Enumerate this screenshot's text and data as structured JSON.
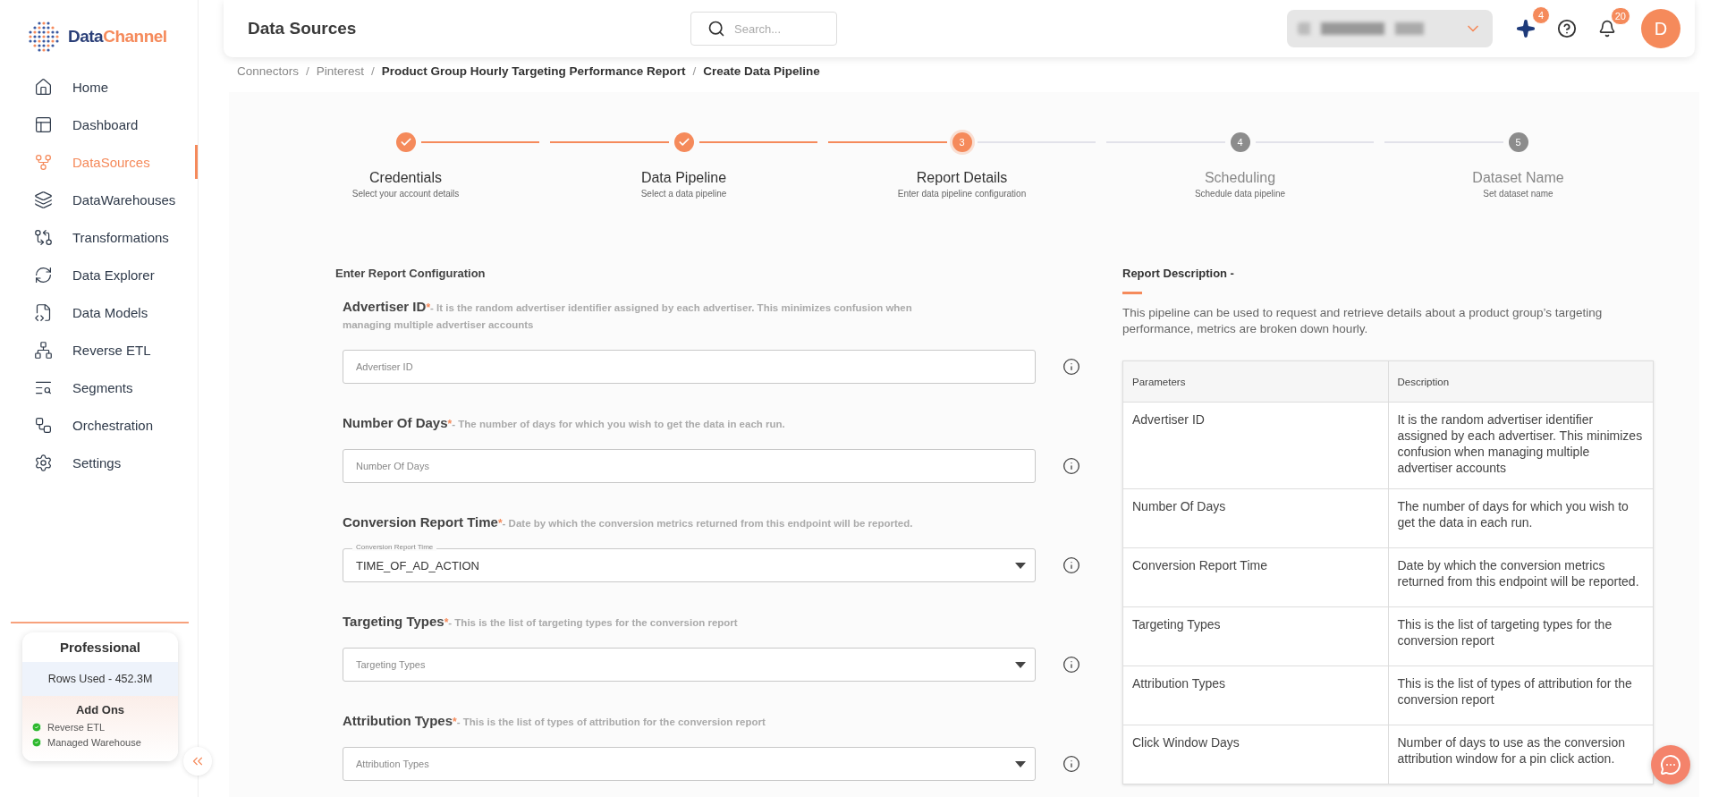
{
  "logo": {
    "first": "Data",
    "second": "Channel"
  },
  "sidebar": {
    "items": [
      {
        "label": "Home",
        "selected": false
      },
      {
        "label": "Dashboard",
        "selected": false
      },
      {
        "label": "DataSources",
        "selected": true
      },
      {
        "label": "DataWarehouses",
        "selected": false
      },
      {
        "label": "Transformations",
        "selected": false
      },
      {
        "label": "Data Explorer",
        "selected": false
      },
      {
        "label": "Data Models",
        "selected": false
      },
      {
        "label": "Reverse ETL",
        "selected": false
      },
      {
        "label": "Segments",
        "selected": false
      },
      {
        "label": "Orchestration",
        "selected": false
      },
      {
        "label": "Settings",
        "selected": false
      }
    ]
  },
  "plan": {
    "title": "Professional",
    "usage": "Rows Used - 452.3M",
    "addons_title": "Add Ons",
    "addons": [
      {
        "label": "Reverse ETL",
        "enabled": true
      },
      {
        "label": "Managed Warehouse",
        "enabled": true
      }
    ]
  },
  "header": {
    "title": "Data Sources",
    "search": {
      "placeholder": "Search..."
    },
    "ai_badge": "4",
    "notifications_badge": "20",
    "avatar": "D"
  },
  "breadcrumb": [
    {
      "label": "Connectors",
      "current": false
    },
    {
      "label": "Pinterest",
      "current": false
    },
    {
      "label": "Product Group Hourly Targeting Performance Report",
      "current": true
    },
    {
      "label": "Create Data Pipeline",
      "current": true
    }
  ],
  "breadcrumb_separator": "/",
  "steps": [
    {
      "title": "Credentials",
      "subtitle": "Select your account details",
      "done": true,
      "selected": false
    },
    {
      "title": "Data Pipeline",
      "subtitle": "Select a data pipeline",
      "done": true,
      "selected": false
    },
    {
      "title": "Report Details",
      "subtitle": "Enter data pipeline configuration",
      "done": false,
      "selected": true,
      "number": "3"
    },
    {
      "title": "Scheduling",
      "subtitle": "Schedule data pipeline",
      "done": false,
      "selected": false,
      "number": "4"
    },
    {
      "title": "Dataset Name",
      "subtitle": "Set dataset name",
      "done": false,
      "selected": false,
      "number": "5"
    }
  ],
  "form": {
    "title": "Enter Report Configuration",
    "required_mark": "*",
    "fields": [
      {
        "kind": "text",
        "label": "Advertiser ID",
        "description": "- It is the random advertiser identifier assigned by each advertiser. This minimizes confusion when managing multiple advertiser accounts",
        "placeholder": "Advertiser ID"
      },
      {
        "kind": "text",
        "label": "Number Of Days",
        "description": "- The number of days for which you wish to get the data in each run.",
        "placeholder": "Number Of Days"
      },
      {
        "kind": "select",
        "label": "Conversion Report Time",
        "description": "- Date by which the conversion metrics returned from this endpoint will be reported.",
        "floating_label": "Conversion Report Time",
        "value": "TIME_OF_AD_ACTION"
      },
      {
        "kind": "select",
        "label": "Targeting Types",
        "description": "- This is the list of targeting types for the conversion report",
        "placeholder": "Targeting Types"
      },
      {
        "kind": "select",
        "label": "Attribution Types",
        "description": "- This is the list of types of attribution for the conversion report",
        "placeholder": "Attribution Types"
      }
    ]
  },
  "report": {
    "title": "Report Description -",
    "summary": "This pipeline can be used to request and retrieve details about a product group’s targeting performance, metrics are broken down hourly.",
    "table": {
      "columns": [
        "Parameters",
        "Description"
      ],
      "rows": [
        [
          "Advertiser ID",
          "It is the random advertiser identifier assigned by each advertiser. This minimizes confusion when managing multiple advertiser accounts"
        ],
        [
          "Number Of Days",
          "The number of days for which you wish to get the data in each run."
        ],
        [
          "Conversion Report Time",
          "Date by which the conversion metrics returned from this endpoint will be reported."
        ],
        [
          "Targeting Types",
          "This is the list of targeting types for the conversion report"
        ],
        [
          "Attribution Types",
          "This is the list of types of attribution for the conversion report"
        ],
        [
          "Click Window Days",
          "Number of days to use as the conversion attribution window for a pin click action."
        ]
      ]
    }
  }
}
